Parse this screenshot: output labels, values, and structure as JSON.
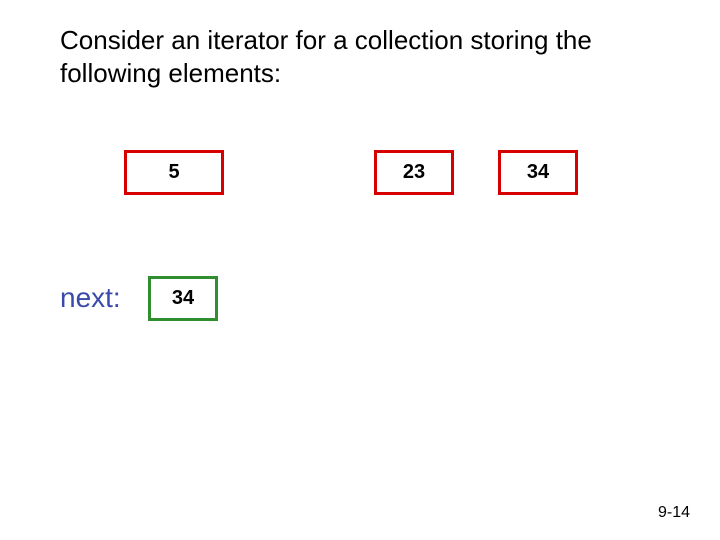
{
  "heading": "Consider an iterator for a collection storing the following elements:",
  "elements": {
    "e0": "5",
    "e1": "23",
    "e2": "34"
  },
  "next_label": "next:",
  "next_value": "34",
  "page_number": "9-14"
}
